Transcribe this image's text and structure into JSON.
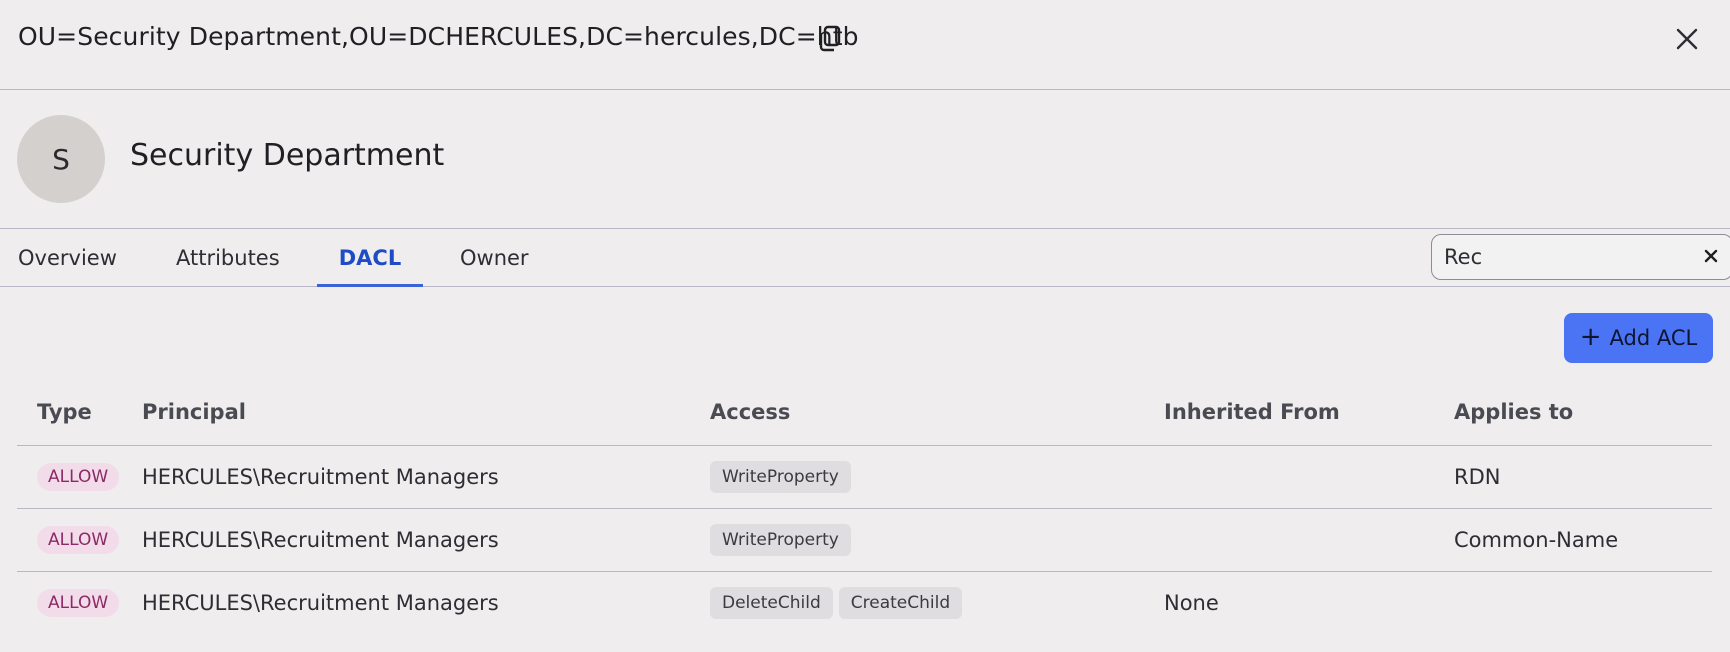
{
  "header": {
    "dn": "OU=Security Department,OU=DCHERCULES,DC=hercules,DC=htb",
    "copy_icon": "copy-icon",
    "close_icon": "close-icon"
  },
  "entity": {
    "avatar_letter": "S",
    "name": "Security Department"
  },
  "tabs": [
    {
      "label": "Overview",
      "active": false
    },
    {
      "label": "Attributes",
      "active": false
    },
    {
      "label": "DACL",
      "active": true
    },
    {
      "label": "Owner",
      "active": false
    }
  ],
  "search": {
    "value": "Rec",
    "clear_icon": "close-icon"
  },
  "actions": {
    "add_acl_label": "Add ACL",
    "add_icon": "plus-icon"
  },
  "table": {
    "columns": [
      "Type",
      "Principal",
      "Access",
      "Inherited From",
      "Applies to"
    ],
    "rows": [
      {
        "type": "ALLOW",
        "principal": "HERCULES\\Recruitment Managers",
        "access": [
          "WriteProperty"
        ],
        "inherited_from": "",
        "applies_to": "RDN"
      },
      {
        "type": "ALLOW",
        "principal": "HERCULES\\Recruitment Managers",
        "access": [
          "WriteProperty"
        ],
        "inherited_from": "",
        "applies_to": "Common-Name"
      },
      {
        "type": "ALLOW",
        "principal": "HERCULES\\Recruitment Managers",
        "access": [
          "DeleteChild",
          "CreateChild"
        ],
        "inherited_from": "None",
        "applies_to": ""
      }
    ]
  },
  "colors": {
    "accent": "#4a74f3",
    "active_tab": "#1f4cc5",
    "allow_badge_bg": "#f2dcea",
    "allow_badge_text": "#8c2a66"
  }
}
